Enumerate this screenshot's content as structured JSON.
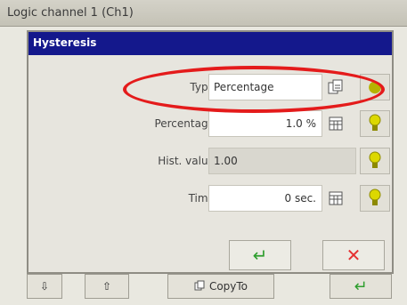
{
  "window": {
    "title": "Logic channel 1 (Ch1)"
  },
  "dialog": {
    "title": "Hysteresis",
    "fields": [
      {
        "label": "Type:",
        "value": "Percentage"
      },
      {
        "label": "Percentage:",
        "value": "1.0 %"
      },
      {
        "label": "Hist. value:",
        "value": "1.00"
      },
      {
        "label": "Time:",
        "value": "0 sec."
      }
    ]
  },
  "toolbar": {
    "down_label": "⇩",
    "up_label": "⇧",
    "copy_label": "CopyTo",
    "ok_label": "↵"
  },
  "dialog_buttons": {
    "ok_label": "↵",
    "cancel_label": "✕"
  },
  "colors": {
    "dialog_title_bg": "#14188c",
    "highlight": "#e41b1b"
  }
}
